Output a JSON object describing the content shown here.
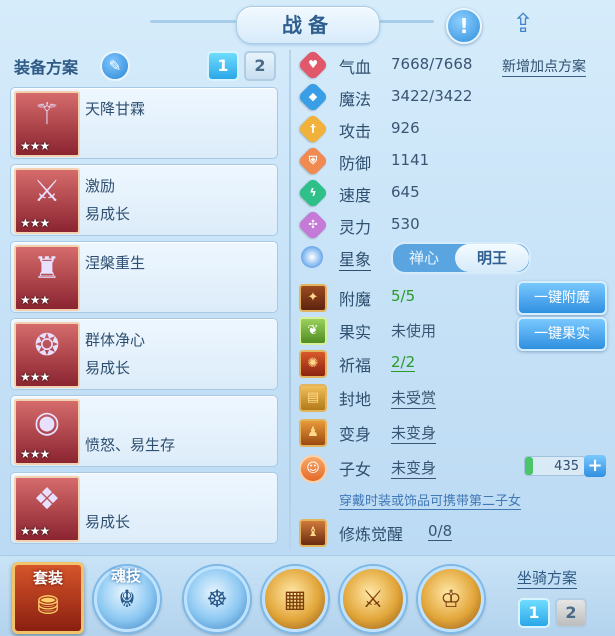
{
  "header": {
    "title": "战备",
    "help_icon": "exclamation-icon",
    "share_icon": "share-icon"
  },
  "equip_plan": {
    "title": "装备方案",
    "plan_buttons": [
      "1",
      "2"
    ],
    "active_plan": "1",
    "items": [
      {
        "name": "天降甘霖",
        "sub": "",
        "stars": "★★★",
        "icon": "staff-icon"
      },
      {
        "name": "激励",
        "sub": "易成长",
        "stars": "★★★",
        "icon": "sword-icon"
      },
      {
        "name": "涅槃重生",
        "sub": "",
        "stars": "★★★",
        "icon": "armor-icon"
      },
      {
        "name": "群体净心",
        "sub": "易成长",
        "stars": "★★★",
        "icon": "necklace-icon"
      },
      {
        "name": "",
        "sub": "愤怒、易生存",
        "stars": "★★★",
        "icon": "belt-icon"
      },
      {
        "name": "",
        "sub": "易成长",
        "stars": "★★★",
        "icon": "boots-icon"
      }
    ]
  },
  "stats": {
    "hp": {
      "label": "气血",
      "value": "7668/7668"
    },
    "mp": {
      "label": "魔法",
      "value": "3422/3422"
    },
    "atk": {
      "label": "攻击",
      "value": "926"
    },
    "def": {
      "label": "防御",
      "value": "1141"
    },
    "spd": {
      "label": "速度",
      "value": "645"
    },
    "spirit": {
      "label": "灵力",
      "value": "530"
    },
    "add_points_link": "新增加点方案"
  },
  "star_sign": {
    "label": "星象",
    "options": [
      "禅心",
      "明王"
    ],
    "selected": "明王"
  },
  "extras": {
    "enchant": {
      "label": "附魔",
      "value": "5/5",
      "button": "一键附魔"
    },
    "fruit": {
      "label": "果实",
      "value": "未使用",
      "button": "一键果实"
    },
    "blessing": {
      "label": "祈福",
      "value": "2/2"
    },
    "fief": {
      "label": "封地",
      "value": "未受赏"
    },
    "transform": {
      "label": "变身",
      "value": "未变身"
    },
    "child": {
      "label": "子女",
      "value": "未变身",
      "count": "435"
    },
    "child_hint": "穿戴时装或饰品可携带第二子女",
    "awaken": {
      "label": "修炼觉醒",
      "value": "0/8"
    }
  },
  "bottom": {
    "suit_label": "套装",
    "soul_label": "魂技",
    "mount_title": "坐骑方案",
    "mount_buttons": [
      "1",
      "2"
    ],
    "active_mount": "1"
  },
  "colors": {
    "accent": "#2f8fe0",
    "green_value": "#2a9a2a",
    "title_text": "#2f5f8f"
  }
}
